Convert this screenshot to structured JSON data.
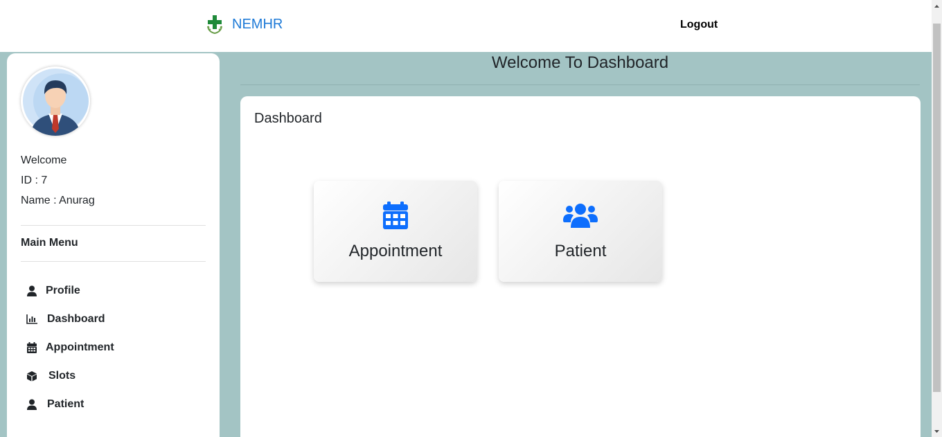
{
  "header": {
    "brand": "NEMHR",
    "logout_label": "Logout",
    "accent_color": "#1e7ad7"
  },
  "sidebar": {
    "welcome": "Welcome",
    "id_text": "ID : 7",
    "name_text": "Name : Anurag",
    "menu_title": "Main Menu",
    "items": [
      {
        "label": "Profile",
        "icon": "user-icon"
      },
      {
        "label": "Dashboard",
        "icon": "chart-bar-icon"
      },
      {
        "label": "Appointment",
        "icon": "calendar-icon"
      },
      {
        "label": "Slots",
        "icon": "cube-icon"
      },
      {
        "label": "Patient",
        "icon": "user-icon"
      }
    ]
  },
  "main": {
    "heading": "Welcome To Dashboard",
    "card_title": "Dashboard",
    "tiles": [
      {
        "label": "Appointment",
        "icon": "calendar-icon"
      },
      {
        "label": "Patient",
        "icon": "users-icon"
      }
    ],
    "tile_icon_color": "#0d6efd"
  }
}
